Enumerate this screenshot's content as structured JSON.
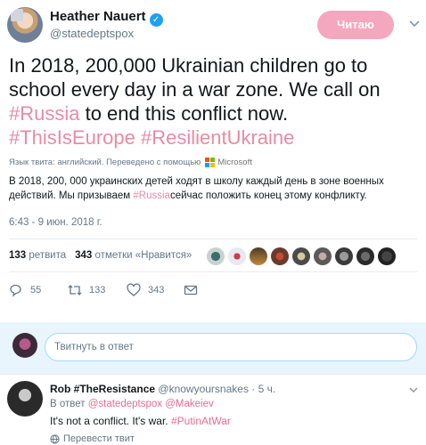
{
  "author": {
    "name": "Heather Nauert",
    "handle": "@statedeptspox",
    "verified_icon": "verified-badge-icon"
  },
  "follow_button": {
    "label": "Читаю",
    "color": "#f5a7bf"
  },
  "tweet": {
    "segments": [
      {
        "text": "In 2018, 200,000 Ukrainian children go to school every day in a war zone. We call on ",
        "hashtag": false
      },
      {
        "text": "#Russia",
        "hashtag": true
      },
      {
        "text": " to end this conflict now. ",
        "hashtag": false
      },
      {
        "text": "#ThisIsEurope",
        "hashtag": true
      },
      {
        "text": " ",
        "hashtag": false
      },
      {
        "text": "#ResilientUkraine",
        "hashtag": true
      }
    ],
    "language_note": "Язык твита: английский. Переведено с помощью",
    "translator": "Microsoft",
    "translation_before": "В 2018, 200, 000 украинских детей ходят в школу каждый день в зоне военных действий. Мы призываем ",
    "translation_tag": "#Russia",
    "translation_after": "сейчас положить конец этому конфликту.",
    "timestamp": "6:43 - 9 июн. 2018 г."
  },
  "stats": {
    "retweets_count": "133",
    "retweets_label": "ретвита",
    "likes_count": "343",
    "likes_label": "отметки «Нравится»"
  },
  "actions": {
    "reply_count": "55",
    "retweet_count": "133",
    "like_count": "343"
  },
  "reply_box": {
    "placeholder": "Твитнуть в ответ"
  },
  "reply": {
    "name": "Rob #TheResistance",
    "handle": "@knowyoursnakes",
    "time": "· 5 ч.",
    "in_reply_to": "В ответ",
    "mentions": "@statedeptspox @Makeiev",
    "text_before": "It's not a conflict. It's war. ",
    "text_tag": "#PutinAtWar",
    "translate_label": "Перевести твит"
  },
  "colors": {
    "accent": "#e36d92",
    "secondary_text": "#657786",
    "reply_bar": "#e8f5fd"
  }
}
